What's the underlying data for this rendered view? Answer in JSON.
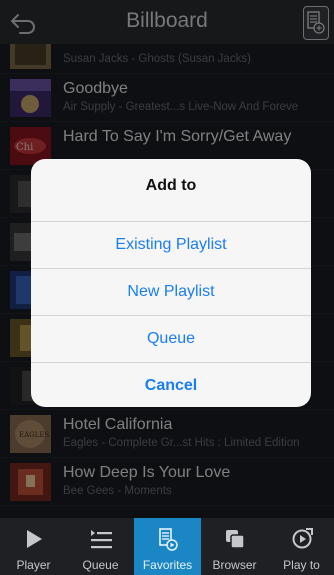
{
  "nav": {
    "title": "Billboard"
  },
  "songs": [
    {
      "title": "",
      "subtitle": "Susan Jacks - Ghosts (Susan Jacks)"
    },
    {
      "title": "Goodbye",
      "subtitle": "Air Supply - Greatest...s Live-Now And Foreve"
    },
    {
      "title": "Hard To Say I'm Sorry/Get Away",
      "subtitle": ""
    },
    {
      "title": "",
      "subtitle": ""
    },
    {
      "title": "",
      "subtitle": ""
    },
    {
      "title": "",
      "subtitle": ""
    },
    {
      "title": "",
      "subtitle": ""
    },
    {
      "title": "",
      "subtitle": ""
    },
    {
      "title": "Hotel California",
      "subtitle": "Eagles - Complete Gr...st Hits : Limited Edition"
    },
    {
      "title": "How Deep Is Your Love",
      "subtitle": "Bee Gees - Moments"
    }
  ],
  "dialog": {
    "title": "Add to",
    "buttons": [
      "Existing Playlist",
      "New Playlist",
      "Queue",
      "Cancel"
    ]
  },
  "tabs": [
    {
      "label": "Player",
      "icon": "play-icon"
    },
    {
      "label": "Queue",
      "icon": "queue-icon"
    },
    {
      "label": "Favorites",
      "icon": "favorites-icon"
    },
    {
      "label": "Browser",
      "icon": "browser-icon"
    },
    {
      "label": "Play to",
      "icon": "play-to-icon"
    }
  ],
  "active_tab": "Favorites",
  "colors": {
    "accent": "#1a87c4",
    "dialog_button": "#1a7ef0"
  }
}
